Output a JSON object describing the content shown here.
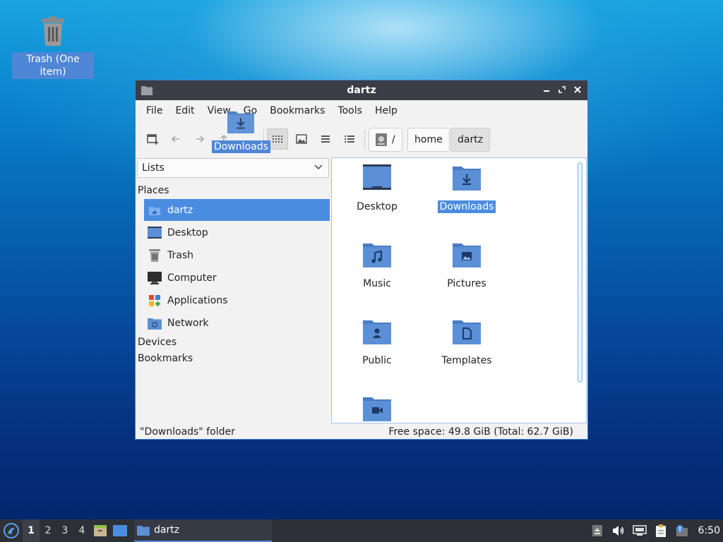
{
  "desktop": {
    "trash_label": "Trash (One item)"
  },
  "window": {
    "title": "dartz",
    "menu": [
      "File",
      "Edit",
      "View",
      "Go",
      "Bookmarks",
      "Tools",
      "Help"
    ],
    "drag_label": "Downloads",
    "breadcrumbs": [
      "/",
      "home",
      "dartz"
    ],
    "side": {
      "combo_value": "Lists",
      "places_header": "Places",
      "places": [
        {
          "label": "dartz",
          "icon": "home-folder-icon"
        },
        {
          "label": "Desktop",
          "icon": "desktop-icon"
        },
        {
          "label": "Trash",
          "icon": "trash-icon"
        },
        {
          "label": "Computer",
          "icon": "computer-icon"
        },
        {
          "label": "Applications",
          "icon": "applications-icon"
        },
        {
          "label": "Network",
          "icon": "network-icon"
        }
      ],
      "devices_header": "Devices",
      "bookmarks_header": "Bookmarks"
    },
    "files": [
      {
        "name": "Desktop",
        "icon": "desktop-folder-icon"
      },
      {
        "name": "Downloads",
        "icon": "downloads-folder-icon"
      },
      {
        "name": "Music",
        "icon": "music-folder-icon"
      },
      {
        "name": "Pictures",
        "icon": "pictures-folder-icon"
      },
      {
        "name": "Public",
        "icon": "public-folder-icon"
      },
      {
        "name": "Templates",
        "icon": "templates-folder-icon"
      },
      {
        "name": "",
        "icon": "videos-folder-icon"
      }
    ],
    "status_left": "\"Downloads\" folder",
    "status_right": "Free space: 49.8 GiB (Total: 62.7 GiB)"
  },
  "taskbar": {
    "workspaces": [
      "1",
      "2",
      "3",
      "4"
    ],
    "task_label": "dartz",
    "clock": "6:50"
  },
  "colors": {
    "accent": "#4a8de0",
    "folder": "#5b8fd6",
    "titlebar": "#3b3e45",
    "taskbar": "#2d3036"
  }
}
